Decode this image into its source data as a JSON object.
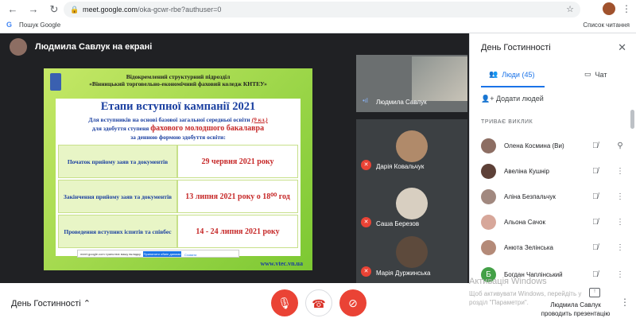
{
  "browser": {
    "url_host": "meet.google.com",
    "url_path": "/oka-gcwr-rbe?authuser=0",
    "bookmark_label": "Пошук Google",
    "reading_list": "Список читання"
  },
  "stage": {
    "presenter_label": "Людмила Савлук на екрані"
  },
  "slide": {
    "header_line1": "Відокремлений структурний підрозділ",
    "header_line2": "«Вінницький торговельно-економічний фаховий коледж КНТЕУ»",
    "title": "Етапи вступної кампанії 2021",
    "line1_a": "Для вступників на основі базової загальної середньої освіти ",
    "line1_b": "(9 кл.)",
    "line2_a": "для здобуття ступеня ",
    "line2_b": "фахового молодшого бакалавра",
    "line3": "за денною формою здобуття освіти:",
    "rows": [
      {
        "label": "Початок прийому заяв та документів",
        "value": "29 червня 2021 року"
      },
      {
        "label": "Закінчення прийому заяв та документів",
        "value": "13 липня 2021 року о 18⁰⁰ год"
      },
      {
        "label": "Проведення вступних іспитів та співбес",
        "value": "14 - 24 липня 2021 року"
      }
    ],
    "url": "www.vtec.vn.ua"
  },
  "share_bar": {
    "text": "meet.google.com транслює вашу вкладку",
    "stop": "Припинити обмін даними",
    "hide": "Сховати"
  },
  "tiles": [
    {
      "name": "Людмила Савлук"
    },
    {
      "name": "Дарія Ковальчук"
    },
    {
      "name": "Саша Березов"
    },
    {
      "name": "Марія Дуржинська"
    }
  ],
  "panel": {
    "title": "День Гостинності",
    "tab_people": "Люди (45)",
    "tab_chat": "Чат",
    "add_people": "Додати людей",
    "section": "ТРИВАЄ ВИКЛИК",
    "people": [
      {
        "name": "Олена Космина (Ви)",
        "color": "#8d6e63",
        "initial": ""
      },
      {
        "name": "Авеліна Кушнір",
        "color": "#5d4037",
        "initial": ""
      },
      {
        "name": "Аліна Безпальчук",
        "color": "#a1887f",
        "initial": ""
      },
      {
        "name": "Альона Сачок",
        "color": "#d7a79a",
        "initial": ""
      },
      {
        "name": "Анюта Зелінська",
        "color": "#b48a78",
        "initial": ""
      },
      {
        "name": "Богдан Чаплінський",
        "color": "#43a047",
        "initial": "Б"
      }
    ]
  },
  "bottom": {
    "meeting_name": "День Гостинності",
    "win_activate": "Активація Windows",
    "win_activate_sub": "Щоб активувати Windows, перейдіть у розділ \"Параметри\".",
    "presenting": "Людмила Савлук проводить презентацію"
  }
}
